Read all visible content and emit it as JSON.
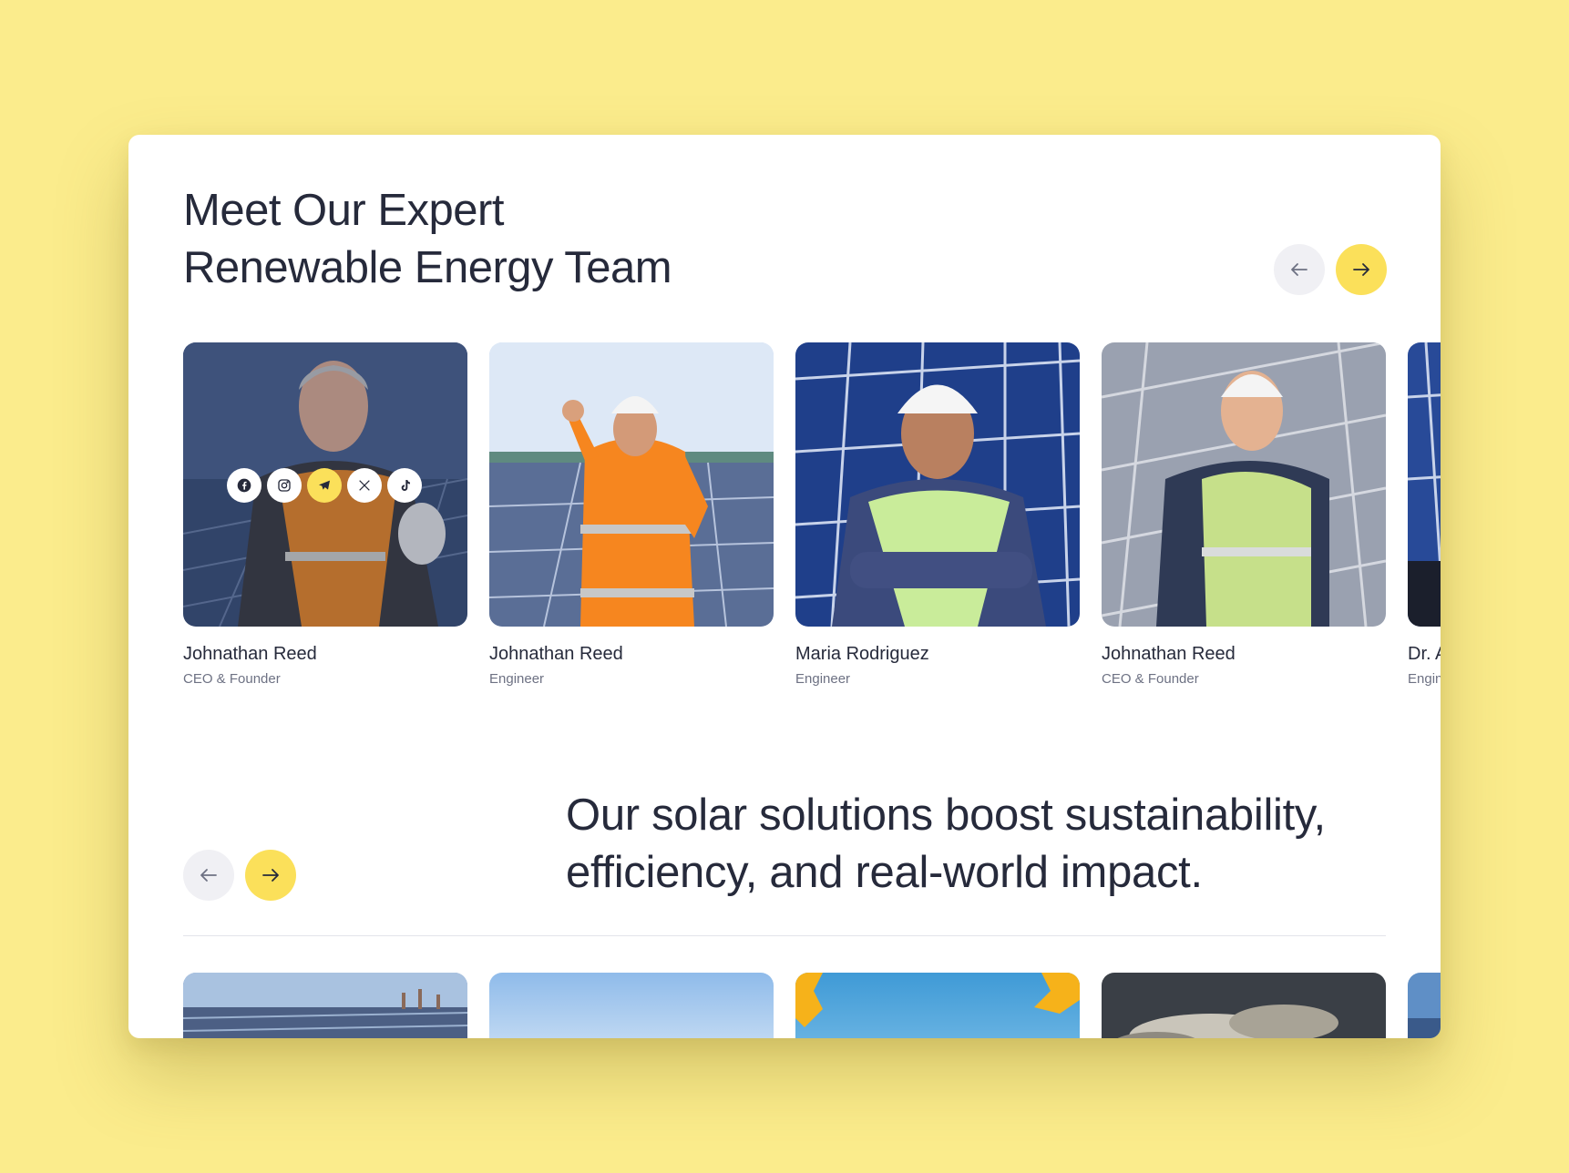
{
  "team": {
    "title_line1": "Meet Our Expert",
    "title_line2": "Renewable Energy Team",
    "prev_icon": "arrow-left-icon",
    "next_icon": "arrow-right-icon",
    "members": [
      {
        "name": "Johnathan Reed",
        "role": "CEO & Founder"
      },
      {
        "name": "Johnathan Reed",
        "role": "Engineer"
      },
      {
        "name": "Maria Rodriguez",
        "role": "Engineer"
      },
      {
        "name": "Johnathan Reed",
        "role": "CEO & Founder"
      },
      {
        "name": "Dr. A",
        "role": "Engineer"
      }
    ],
    "socials": [
      "facebook-icon",
      "instagram-icon",
      "telegram-icon",
      "x-icon",
      "tiktok-icon"
    ]
  },
  "projects": {
    "headline_line1": "Our solar solutions boost sustainability,",
    "headline_line2": "efficiency, and real-world impact.",
    "prev_icon": "arrow-left-icon",
    "next_icon": "arrow-right-icon"
  },
  "colors": {
    "page_background": "#fbec8c",
    "accent": "#fbe05a",
    "text": "#262a3b",
    "muted": "#6d7183"
  }
}
